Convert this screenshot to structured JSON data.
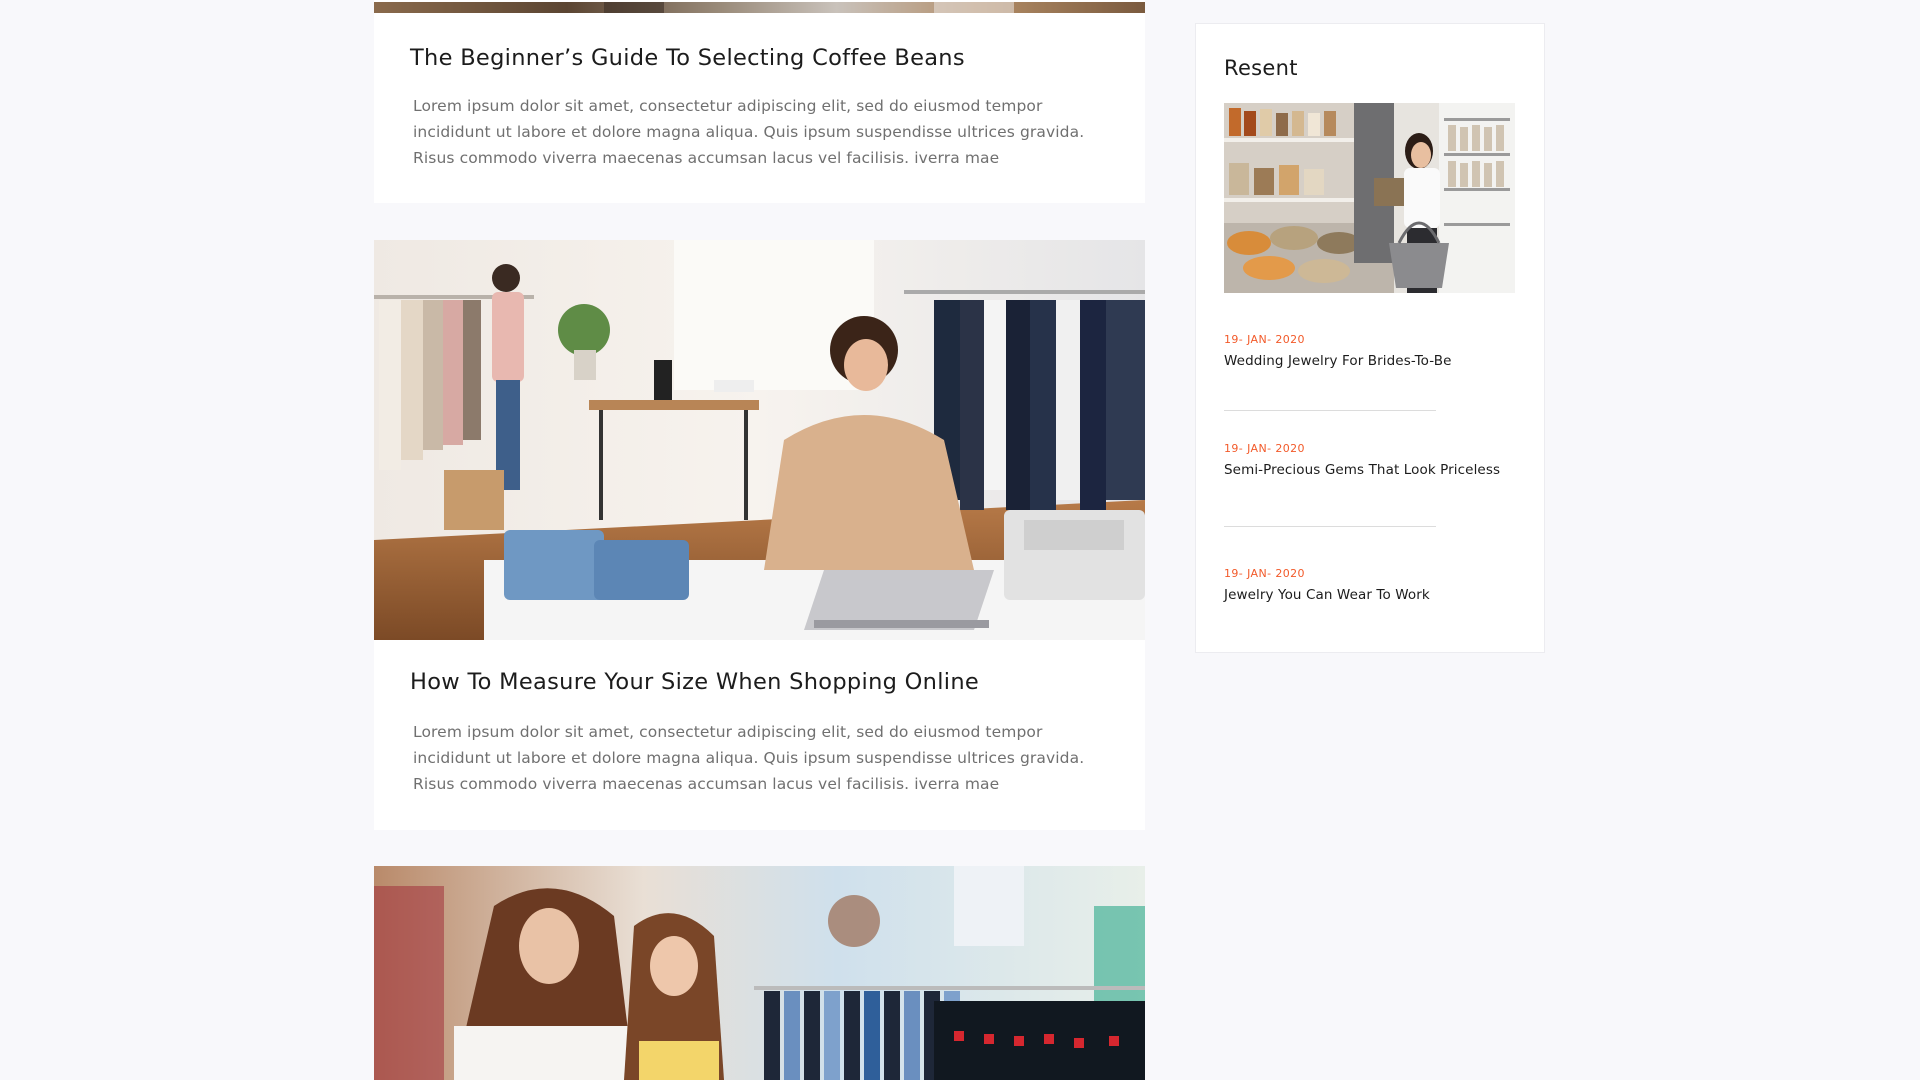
{
  "posts": [
    {
      "title": "The Beginner’s Guide To Selecting Coffee Beans",
      "excerpt": "Lorem ipsum dolor sit amet, consectetur adipiscing elit, sed do eiusmod tempor incididunt ut labore et dolore magna aliqua. Quis ipsum suspendisse ultrices gravida. Risus commodo viverra maecenas accumsan lacus vel facilisis. iverra mae"
    },
    {
      "title": "How To Measure Your Size When Shopping Online",
      "excerpt": "Lorem ipsum dolor sit amet, consectetur adipiscing elit, sed do eiusmod tempor incididunt ut labore et dolore magna aliqua. Quis ipsum suspendisse ultrices gravida. Risus commodo viverra maecenas accumsan lacus vel facilisis. iverra mae"
    }
  ],
  "sidebar": {
    "title": "Resent",
    "items": [
      {
        "date": "19- JAN- 2020",
        "title": "Wedding Jewelry For Brides-To-Be"
      },
      {
        "date": "19- JAN- 2020",
        "title": "Semi-Precious Gems That Look Priceless"
      },
      {
        "date": "19- JAN- 2020",
        "title": "Jewelry You Can Wear To Work"
      }
    ]
  },
  "colors": {
    "accent": "#f25a2a",
    "background": "#f8f8fb",
    "card": "#ffffff",
    "heading": "#1c1c1c",
    "body_text": "#707070"
  }
}
